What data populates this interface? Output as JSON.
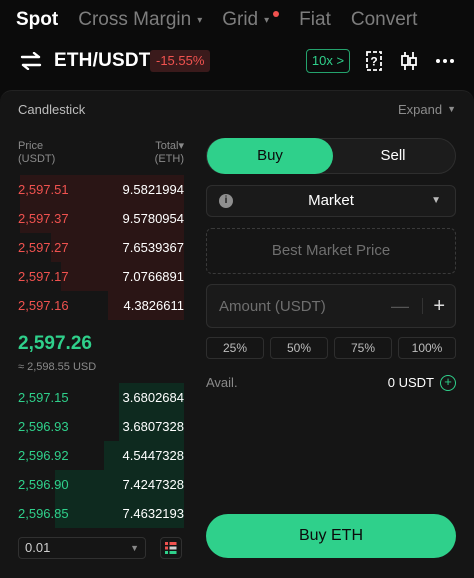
{
  "tabs": [
    {
      "label": "Spot",
      "active": true
    },
    {
      "label": "Cross Margin",
      "caret": "▾"
    },
    {
      "label": "Grid",
      "caret": "▾",
      "badge": "red-dot"
    },
    {
      "label": "Fiat"
    },
    {
      "label": "Convert"
    }
  ],
  "header": {
    "pair": "ETH/USDT",
    "change": "-15.55%",
    "leverage": "10x",
    "leverage_caret": ">"
  },
  "chart_toggle": {
    "label": "Candlestick",
    "expand": "Expand"
  },
  "orderbook": {
    "price_header": "Price",
    "price_unit": "(USDT)",
    "total_header": "Total",
    "total_unit": "(ETH)",
    "asks": [
      {
        "price": "2,597.51",
        "total": "9.5821994",
        "depth": 0.99
      },
      {
        "price": "2,597.37",
        "total": "9.5780954",
        "depth": 0.99
      },
      {
        "price": "2,597.27",
        "total": "7.6539367",
        "depth": 0.8
      },
      {
        "price": "2,597.17",
        "total": "7.0766891",
        "depth": 0.74
      },
      {
        "price": "2,597.16",
        "total": "4.3826611",
        "depth": 0.46
      }
    ],
    "last_price": "2,597.26",
    "last_price_usd": "≈ 2,598.55 USD",
    "bids": [
      {
        "price": "2,597.15",
        "total": "3.6802684",
        "depth": 0.39
      },
      {
        "price": "2,596.93",
        "total": "3.6807328",
        "depth": 0.39
      },
      {
        "price": "2,596.92",
        "total": "4.5447328",
        "depth": 0.48
      },
      {
        "price": "2,596.90",
        "total": "7.4247328",
        "depth": 0.78
      },
      {
        "price": "2,596.85",
        "total": "7.4632193",
        "depth": 0.78
      }
    ],
    "precision": "0.01"
  },
  "order_form": {
    "buy_label": "Buy",
    "sell_label": "Sell",
    "order_type": "Market",
    "best_price": "Best Market Price",
    "amount_placeholder": "Amount (USDT)",
    "percentages": [
      "25%",
      "50%",
      "75%",
      "100%"
    ],
    "avail_label": "Avail.",
    "avail_value": "0 USDT",
    "submit_label": "Buy ETH"
  },
  "colors": {
    "green": "#2fd08b",
    "red": "#f0524f",
    "background": "#0b0b0b",
    "panel": "#151515"
  }
}
